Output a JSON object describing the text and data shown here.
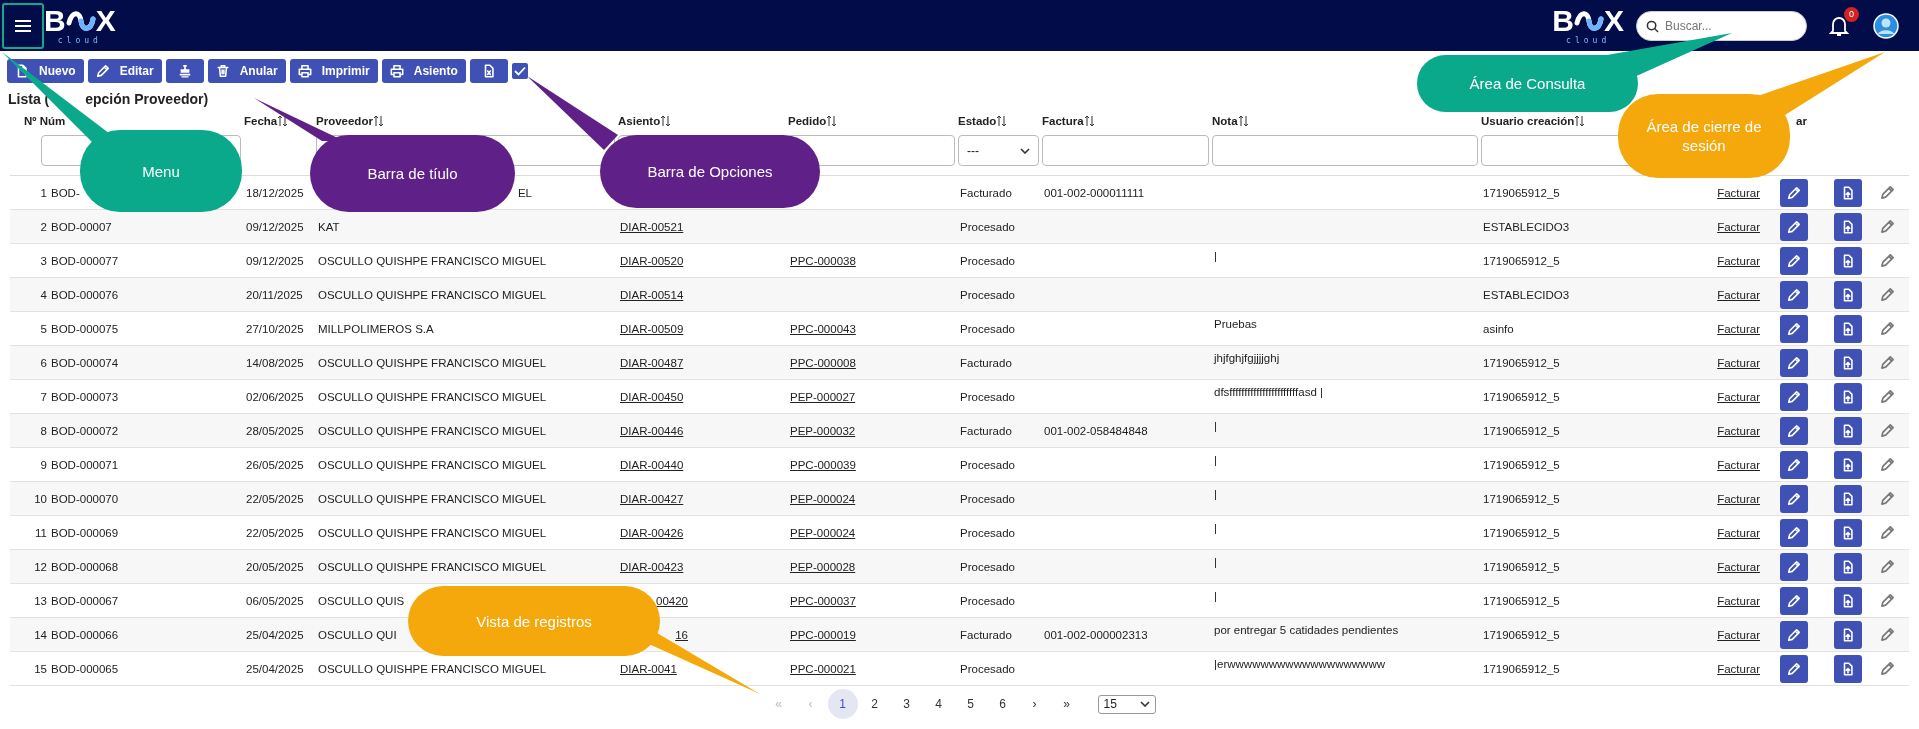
{
  "header": {
    "logo_left": {
      "start": "B",
      "end": "X",
      "tagline": "cloud"
    },
    "logo_right": {
      "start": "B",
      "end": "X",
      "tagline": "cloud"
    },
    "search": {
      "placeholder": "Buscar..."
    },
    "notifications": {
      "count": "0"
    }
  },
  "toolbar": {
    "buttons": [
      {
        "kind": "new",
        "label": "Nuevo"
      },
      {
        "kind": "edit",
        "label": "Editar"
      },
      {
        "kind": "approve"
      },
      {
        "kind": "void",
        "label": "Anular"
      },
      {
        "kind": "print",
        "label": "Imprimir"
      },
      {
        "kind": "entry",
        "label": "Asiento"
      },
      {
        "kind": "export"
      }
    ],
    "checkbox": {
      "checked": true
    }
  },
  "title": "Lista (",
  "title_tail": "epción Proveedor)",
  "table": {
    "columns": [
      {
        "label": "Nº Núm",
        "sortable": false,
        "kind": "input"
      },
      {
        "label": "Fecha",
        "sortable": true,
        "kind": "plain"
      },
      {
        "label": "Proveedor",
        "sortable": true,
        "kind": "input"
      },
      {
        "label": "Asiento",
        "sortable": true,
        "kind": "input"
      },
      {
        "label": "Pedido",
        "sortable": true,
        "kind": "input"
      },
      {
        "label": "Estado",
        "sortable": true,
        "kind": "select",
        "value": "---"
      },
      {
        "label": "Factura",
        "sortable": true,
        "kind": "input"
      },
      {
        "label": "Nota",
        "sortable": true,
        "kind": "input"
      },
      {
        "label": "Usuario creación",
        "sortable": true,
        "kind": "input"
      },
      {
        "label": "ar",
        "sortable": false,
        "kind": "plain"
      }
    ],
    "rows": [
      {
        "n": "1",
        "code": "BOD-",
        "date": "18/12/2025",
        "supplier": "EL",
        "supplier_cut": true,
        "status": "Facturado",
        "invoice": "001-002-000011111",
        "user": "1719065912_5",
        "action": "Facturar"
      },
      {
        "n": "2",
        "code": "BOD-00007",
        "date": "09/12/2025",
        "supplier": "KAT",
        "entry": "DIAR-00521",
        "status": "Procesado",
        "user": "ESTABLECIDO3",
        "action": "Facturar"
      },
      {
        "n": "3",
        "code": "BOD-000077",
        "date": "09/12/2025",
        "supplier": "OSCULLO QUISHPE FRANCISCO MIGUEL",
        "entry": "DIAR-00520",
        "order": "PPC-000038",
        "status": "Procesado",
        "note": "|",
        "user": "1719065912_5",
        "action": "Facturar"
      },
      {
        "n": "4",
        "code": "BOD-000076",
        "date": "20/11/2025",
        "supplier": "OSCULLO QUISHPE FRANCISCO MIGUEL",
        "entry": "DIAR-00514",
        "status": "Procesado",
        "user": "ESTABLECIDO3",
        "action": "Facturar"
      },
      {
        "n": "5",
        "code": "BOD-000075",
        "date": "27/10/2025",
        "supplier": "MILLPOLIMEROS S.A",
        "entry": "DIAR-00509",
        "order": "PPC-000043",
        "status": "Procesado",
        "note": "Pruebas",
        "user": "asinfo",
        "action": "Facturar"
      },
      {
        "n": "6",
        "code": "BOD-000074",
        "date": "14/08/2025",
        "supplier": "OSCULLO QUISHPE FRANCISCO MIGUEL",
        "entry": "DIAR-00487",
        "order": "PPC-000008",
        "status": "Facturado",
        "note": "jhjfghjfgjjjjghj",
        "user": "1719065912_5",
        "action": "Facturar"
      },
      {
        "n": "7",
        "code": "BOD-000073",
        "date": "02/06/2025",
        "supplier": "OSCULLO QUISHPE FRANCISCO MIGUEL",
        "entry": "DIAR-00450",
        "order": "PEP-000027",
        "status": "Procesado",
        "note": "dfsfffffffffffffffffffffffasd |",
        "user": "1719065912_5",
        "action": "Facturar"
      },
      {
        "n": "8",
        "code": "BOD-000072",
        "date": "28/05/2025",
        "supplier": "OSCULLO QUISHPE FRANCISCO MIGUEL",
        "entry": "DIAR-00446",
        "order": "PEP-000032",
        "status": "Facturado",
        "invoice": "001-002-058484848",
        "note": "|",
        "user": "1719065912_5",
        "action": "Facturar"
      },
      {
        "n": "9",
        "code": "BOD-000071",
        "date": "26/05/2025",
        "supplier": "OSCULLO QUISHPE FRANCISCO MIGUEL",
        "entry": "DIAR-00440",
        "order": "PPC-000039",
        "status": "Procesado",
        "note": "|",
        "user": "1719065912_5",
        "action": "Facturar"
      },
      {
        "n": "10",
        "code": "BOD-000070",
        "date": "22/05/2025",
        "supplier": "OSCULLO QUISHPE FRANCISCO MIGUEL",
        "entry": "DIAR-00427",
        "order": "PEP-000024",
        "status": "Procesado",
        "note": "|",
        "user": "1719065912_5",
        "action": "Facturar"
      },
      {
        "n": "11",
        "code": "BOD-000069",
        "date": "22/05/2025",
        "supplier": "OSCULLO QUISHPE FRANCISCO MIGUEL",
        "entry": "DIAR-00426",
        "order": "PEP-000024",
        "status": "Procesado",
        "note": "|",
        "user": "1719065912_5",
        "action": "Facturar"
      },
      {
        "n": "12",
        "code": "BOD-000068",
        "date": "20/05/2025",
        "supplier": "OSCULLO QUISHPE FRANCISCO MIGUEL",
        "entry": "DIAR-00423",
        "order": "PEP-000028",
        "status": "Procesado",
        "note": "|",
        "user": "1719065912_5",
        "action": "Facturar"
      },
      {
        "n": "13",
        "code": "BOD-000067",
        "date": "06/05/2025",
        "supplier": "OSCULLO QUIS",
        "entry": "00420",
        "entry_cut": true,
        "order": "PPC-000037",
        "status": "Procesado",
        "note": "|",
        "user": "1719065912_5",
        "action": "Facturar"
      },
      {
        "n": "14",
        "code": "BOD-000066",
        "date": "25/04/2025",
        "supplier": "OSCULLO QUI",
        "entry": "16",
        "entry_cut": true,
        "order": "PPC-000019",
        "status": "Facturado",
        "invoice": "001-002-000002313",
        "note": "por entregar 5 catidades pendientes",
        "user": "1719065912_5",
        "action": "Facturar"
      },
      {
        "n": "15",
        "code": "BOD-000065",
        "date": "25/04/2025",
        "supplier": "OSCULLO QUISHPE FRANCISCO MIGUEL",
        "entry": "DIAR-0041",
        "order": "PPC-000021",
        "status": "Procesado",
        "note": "|erwwwwwwwwwwwwwwwwwww",
        "user": "1719065912_5",
        "action": "Facturar"
      }
    ]
  },
  "pagination": {
    "items": [
      {
        "label": "«",
        "selected": false,
        "disabled": true
      },
      {
        "label": "‹",
        "selected": false,
        "disabled": true
      },
      {
        "label": "1",
        "selected": true,
        "disabled": false
      },
      {
        "label": "2",
        "selected": false,
        "disabled": false
      },
      {
        "label": "3",
        "selected": false,
        "disabled": false
      },
      {
        "label": "4",
        "selected": false,
        "disabled": false
      },
      {
        "label": "5",
        "selected": false,
        "disabled": false
      },
      {
        "label": "6",
        "selected": false,
        "disabled": false
      },
      {
        "label": "›",
        "selected": false,
        "disabled": false
      },
      {
        "label": "»",
        "selected": false,
        "disabled": false
      }
    ],
    "page_size": "15"
  },
  "annotations": [
    {
      "text": "Menu",
      "color": "#0aa98b"
    },
    {
      "text": "Barra de tíulo",
      "color": "#5f2187"
    },
    {
      "text": "Barra de Opciones",
      "color": "#5f2187"
    },
    {
      "text": "Área de Consulta",
      "color": "#0aa98b"
    },
    {
      "text": "Área de cierre de sesión",
      "color": "#f5a80b"
    },
    {
      "text": "Vista de registros",
      "color": "#f5a80b"
    }
  ]
}
